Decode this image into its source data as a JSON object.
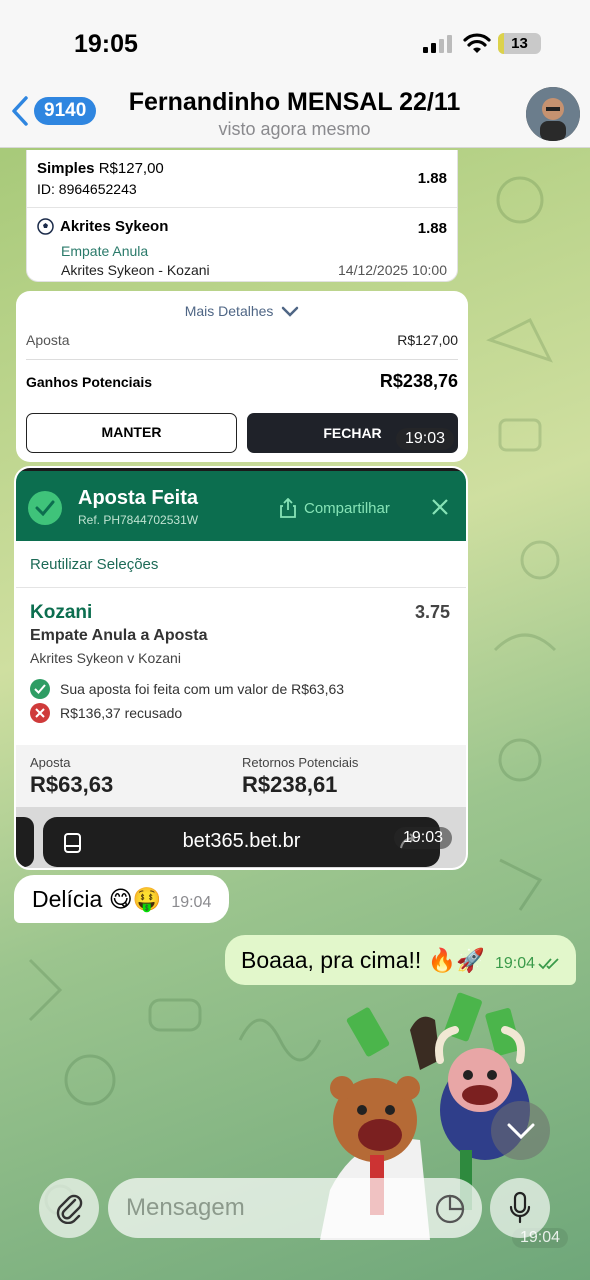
{
  "status": {
    "time": "19:05",
    "battery": "13",
    "battery_level": 0.13
  },
  "header": {
    "back_count": "9140",
    "title": "Fernandinho MENSAL 22/11",
    "subtitle": "visto agora mesmo"
  },
  "bet_slip": {
    "simples_label": "Simples",
    "simples_amount": "R$127,00",
    "bet_id": "ID: 8964652243",
    "simples_odds": "1.88",
    "selection": "Akrites Sykeon",
    "selection_odds": "1.88",
    "market": "Empate Anula",
    "fixture": "Akrites Sykeon - Kozani",
    "date": "14/12/2025 10:00",
    "more_details": "Mais Detalhes",
    "stake_label": "Aposta",
    "stake_value": "R$127,00",
    "potential_label": "Ganhos Potenciais",
    "potential_value": "R$238,76",
    "keep_button": "MANTER",
    "cashout_button": "FECHAR",
    "time": "19:03"
  },
  "receipt": {
    "title": "Aposta Feita",
    "ref": "Ref. PH7844702531W",
    "share": "Compartilhar",
    "reuse": "Reutilizar Seleções",
    "selection": "Kozani",
    "odds": "3.75",
    "market": "Empate Anula a Aposta",
    "fixture": "Akrites Sykeon v Kozani",
    "accepted": "Sua aposta foi feita com um valor de R$63,63",
    "rejected": "R$136,37 recusado",
    "stake_label": "Aposta",
    "stake_value": "R$63,63",
    "returns_label": "Retornos Potenciais",
    "returns_value": "R$238,61",
    "url": "bet365.bet.br",
    "time": "19:03"
  },
  "messages": {
    "incoming_text": "Delícia 😋🤑",
    "incoming_time": "19:04",
    "outgoing_text": "Boaaa, pra cima!! 🔥🚀",
    "outgoing_time": "19:04",
    "sticker_time": "19:04"
  },
  "composer": {
    "placeholder": "Mensagem"
  },
  "colors": {
    "accent": "#2f86e0",
    "bet_green": "#0c6e4f",
    "outgoing_bubble": "#e2f7cb"
  }
}
